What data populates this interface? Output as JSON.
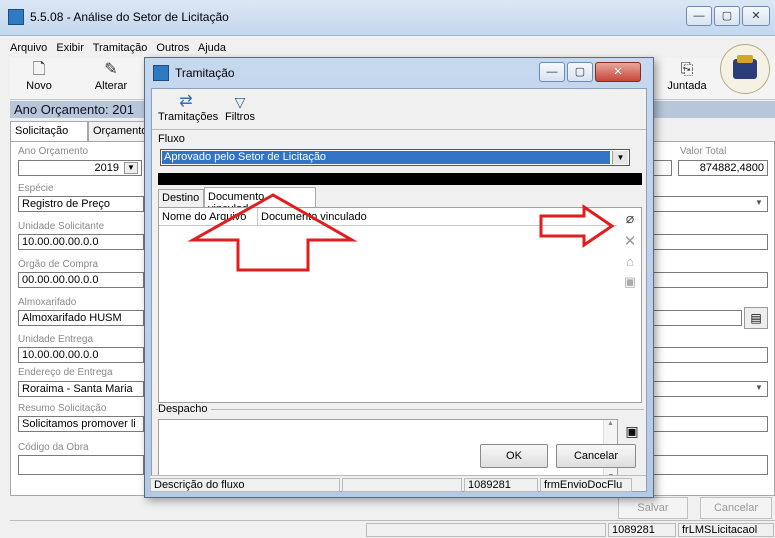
{
  "window": {
    "title": "5.5.08 - Análise do Setor de Licitação",
    "controls": [
      "—",
      "▢",
      "✕"
    ]
  },
  "menu": [
    "Arquivo",
    "Exibir",
    "Tramitação",
    "Outros",
    "Ajuda"
  ],
  "toolbar": {
    "novo": "Novo",
    "alterar": "Alterar",
    "juntada": "Juntada"
  },
  "year_bar": "Ano Orçamento: 201",
  "tabs": [
    "Solicitação",
    "Orçamento"
  ],
  "form": {
    "ano_orcamento": {
      "label": "Ano Orçamento",
      "value": "2019"
    },
    "especie": {
      "label": "Espécie",
      "value": "Registro de Preço"
    },
    "unidade_solicitante": {
      "label": "Unidade Solicitante",
      "value": "10.00.00.00.0.0"
    },
    "orgao_compra": {
      "label": "Órgão de Compra",
      "value": "00.00.00.00.0.0"
    },
    "almoxarifado": {
      "label": "Almoxarifado",
      "value": "Almoxarifado HUSM"
    },
    "unidade_entrega": {
      "label": "Unidade Entrega",
      "value": "10.00.00.00.0.0"
    },
    "endereco_entrega": {
      "label": "Endereço de Entrega",
      "value": "Roraima - Santa Maria"
    },
    "resumo_solicitacao": {
      "label": "Resumo Solicitação",
      "value": "Solicitamos promover li"
    },
    "codigo_obra": {
      "label": "Código da Obra",
      "value": ""
    },
    "valor_total": {
      "label": "Valor Total",
      "value": "874882,4800"
    }
  },
  "bottom_buttons": {
    "salvar": "Salvar",
    "cancelar": "Cancelar"
  },
  "statusbar": {
    "code": "1089281",
    "form": "frLMSLicitacaol"
  },
  "dialog": {
    "title": "Tramitação",
    "toolbar": {
      "tramitacoes": "Tramitações",
      "filtros": "Filtros"
    },
    "fluxo_label": "Fluxo",
    "fluxo_value": "Aprovado pelo Setor de Licitação",
    "tabs": [
      "Destino",
      "Documento vinculado"
    ],
    "columns": [
      "Nome do Arquivo",
      "Documento vinculado"
    ],
    "despacho_label": "Despacho",
    "ok": "OK",
    "cancelar": "Cancelar",
    "status": {
      "descricao": "Descrição do fluxo",
      "code": "1089281",
      "form": "frmEnvioDocFlu"
    }
  },
  "colors": {
    "annotation": "#e11d1d",
    "selection": "#3173c6"
  }
}
